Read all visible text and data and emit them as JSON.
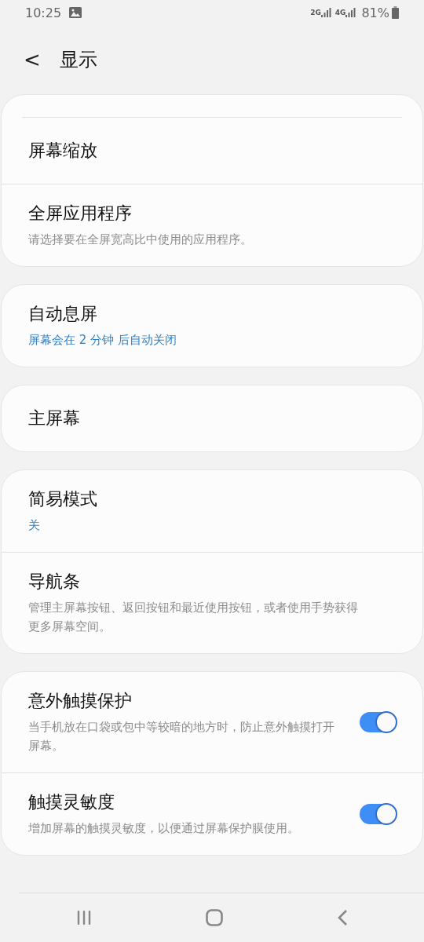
{
  "status_bar": {
    "time": "10:25",
    "network_1": "2G",
    "network_2": "4G",
    "battery": "81%"
  },
  "header": {
    "back": "<",
    "title": "显示"
  },
  "sections": [
    {
      "clipped_top": true,
      "items": [
        {
          "kind": "plain",
          "title": "屏幕缩放"
        },
        {
          "kind": "plain",
          "title": "全屏应用程序",
          "summary": {
            "kind": "muted",
            "text": "请选择要在全屏宽高比中使用的应用程序。"
          }
        }
      ]
    },
    {
      "items": [
        {
          "kind": "plain",
          "title": "自动息屏",
          "summary": {
            "kind": "accent",
            "text": "屏幕会在 2 分钟 后自动关闭"
          }
        }
      ]
    },
    {
      "items": [
        {
          "kind": "plain",
          "title": "主屏幕"
        }
      ]
    },
    {
      "items": [
        {
          "kind": "plain",
          "title": "简易模式",
          "summary": {
            "kind": "accent",
            "text": "关"
          }
        },
        {
          "kind": "plain",
          "title": "导航条",
          "summary": {
            "kind": "muted",
            "text": "管理主屏幕按钮、返回按钮和最近使用按钮，或者使用手势获得更多屏幕空间。"
          }
        }
      ]
    },
    {
      "items": [
        {
          "kind": "toggle",
          "title": "意外触摸保护",
          "on": true,
          "summary": {
            "kind": "muted",
            "text": "当手机放在口袋或包中等较暗的地方时，防止意外触摸打开屏幕。"
          }
        },
        {
          "kind": "toggle",
          "title": "触摸灵敏度",
          "on": true,
          "summary": {
            "kind": "muted",
            "text": "增加屏幕的触摸灵敏度，以便通过屏幕保护膜使用。"
          }
        }
      ]
    }
  ]
}
